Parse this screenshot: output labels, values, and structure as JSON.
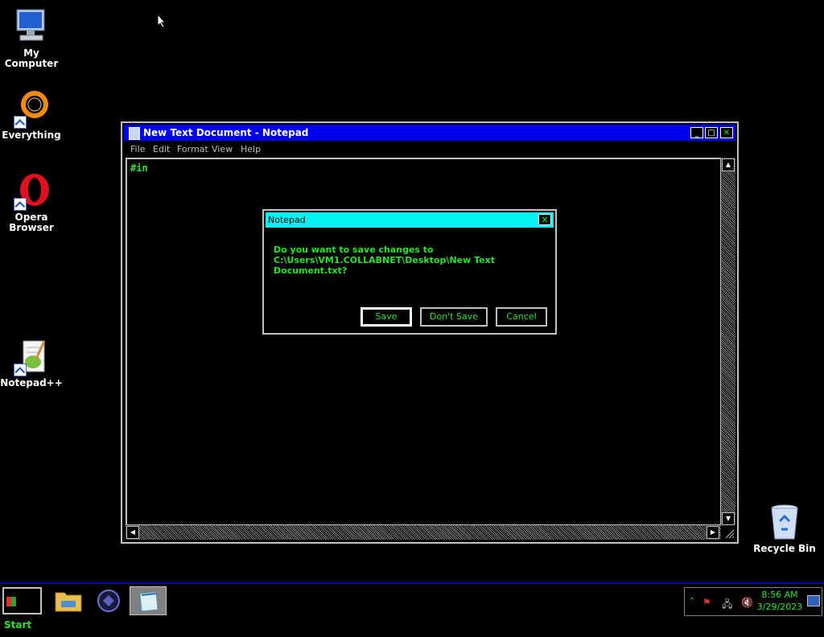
{
  "desktop": {
    "icons": [
      {
        "label": "My Computer"
      },
      {
        "label": "Everything"
      },
      {
        "label": "Opera Browser"
      },
      {
        "label": "Notepad++"
      },
      {
        "label": "Recycle Bin"
      }
    ]
  },
  "notepad": {
    "title": "New Text Document - Notepad",
    "menu": [
      "File",
      "Edit",
      "Format",
      "View",
      "Help"
    ],
    "content": "#in"
  },
  "dialog": {
    "title": "Notepad",
    "message": "Do you want to save changes to C:\\Users\\VM1.COLLABNET\\Desktop\\New Text Document.txt?",
    "buttons": {
      "save": "Save",
      "dont_save": "Don't Save",
      "cancel": "Cancel"
    }
  },
  "taskbar": {
    "start_label": "Start",
    "clock": {
      "time": "8:56 AM",
      "date": "3/29/2023"
    }
  },
  "colors": {
    "title_bar": "#0000f0",
    "dialog_title_bar": "#00f2f2",
    "text_green": "#22e822"
  }
}
